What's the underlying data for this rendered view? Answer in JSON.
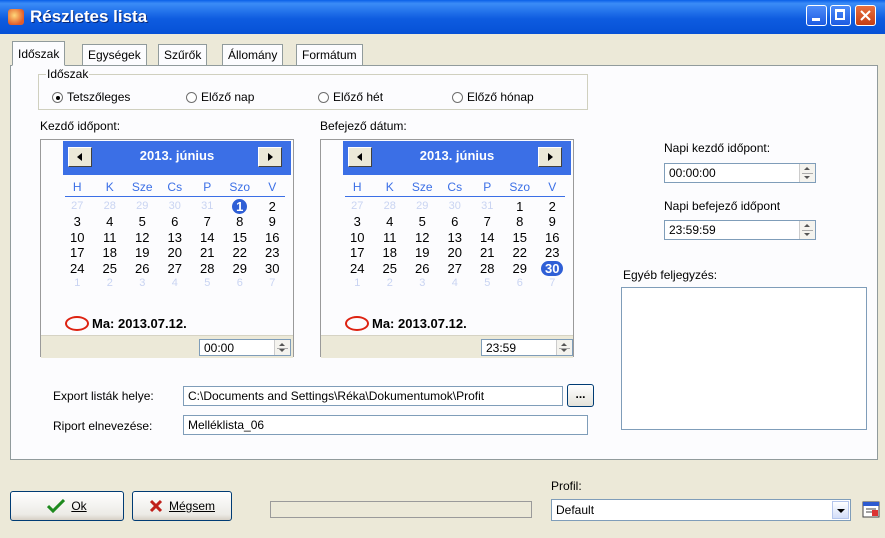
{
  "window": {
    "title": "Részletes lista",
    "controls": [
      "minimize",
      "maximize",
      "close"
    ]
  },
  "tabs": [
    {
      "label": "Időszak",
      "active": true
    },
    {
      "label": "Egységek"
    },
    {
      "label": "Szűrők"
    },
    {
      "label": "Állomány"
    },
    {
      "label": "Formátum"
    }
  ],
  "period": {
    "caption": "Időszak",
    "options": [
      {
        "label": "Tetszőleges",
        "selected": true
      },
      {
        "label": "Előző nap"
      },
      {
        "label": "Előző hét"
      },
      {
        "label": "Előző hónap"
      }
    ]
  },
  "start": {
    "label": "Kezdő időpont:",
    "month": "2013. június",
    "day_names": [
      "H",
      "K",
      "Sze",
      "Cs",
      "P",
      "Szo",
      "V"
    ],
    "weeks": [
      [
        "27",
        "28",
        "29",
        "30",
        "31",
        "1",
        "2"
      ],
      [
        "3",
        "4",
        "5",
        "6",
        "7",
        "8",
        "9"
      ],
      [
        "10",
        "11",
        "12",
        "13",
        "14",
        "15",
        "16"
      ],
      [
        "17",
        "18",
        "19",
        "20",
        "21",
        "22",
        "23"
      ],
      [
        "24",
        "25",
        "26",
        "27",
        "28",
        "29",
        "30"
      ],
      [
        "1",
        "2",
        "3",
        "4",
        "5",
        "6",
        "7"
      ]
    ],
    "today": "Ma: 2013.07.12.",
    "time": "00:00"
  },
  "end": {
    "label": "Befejező dátum:",
    "month": "2013. június",
    "day_names": [
      "H",
      "K",
      "Sze",
      "Cs",
      "P",
      "Szo",
      "V"
    ],
    "weeks": [
      [
        "27",
        "28",
        "29",
        "30",
        "31",
        "1",
        "2"
      ],
      [
        "3",
        "4",
        "5",
        "6",
        "7",
        "8",
        "9"
      ],
      [
        "10",
        "11",
        "12",
        "13",
        "14",
        "15",
        "16"
      ],
      [
        "17",
        "18",
        "19",
        "20",
        "21",
        "22",
        "23"
      ],
      [
        "24",
        "25",
        "26",
        "27",
        "28",
        "29",
        "30"
      ],
      [
        "1",
        "2",
        "3",
        "4",
        "5",
        "6",
        "7"
      ]
    ],
    "today": "Ma: 2013.07.12.",
    "time": "23:59"
  },
  "daily": {
    "start_label": "Napi kezdő időpont:",
    "start_value": "00:00:00",
    "end_label": "Napi befejező időpont",
    "end_value": "23:59:59"
  },
  "notes": {
    "label": "Egyéb feljegyzés:",
    "value": ""
  },
  "export": {
    "label": "Export listák helye:",
    "value": "C:\\Documents and Settings\\Réka\\Dokumentumok\\Profit",
    "browse_label": "..."
  },
  "report": {
    "label": "Riport elnevezése:",
    "value": "Melléklista_06"
  },
  "buttons": {
    "ok": "Ok",
    "cancel": "Mégsem"
  },
  "profile": {
    "label": "Profil:",
    "value": "Default"
  },
  "colors": {
    "title_bar": "#0A5FE8",
    "calendar_header": "#3B6FE6",
    "face": "#ECE9D8"
  }
}
